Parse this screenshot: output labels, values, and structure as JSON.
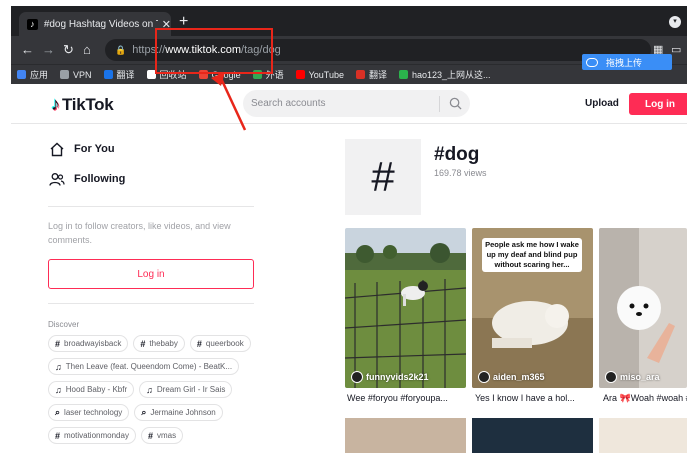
{
  "browser": {
    "tab_title": "#dog Hashtag Videos on TikTok",
    "tab_close": "✕",
    "new_tab": "+",
    "url_proto": "https://",
    "url_host": "www.tiktok.com",
    "url_path": "/tag/dog",
    "bookmarks": [
      {
        "label": "应用",
        "color": "#4285f4"
      },
      {
        "label": "VPN",
        "color": "#9aa0a6"
      },
      {
        "label": "翻译",
        "color": "#1a73e8"
      },
      {
        "label": "回收站",
        "color": "#ffffff"
      },
      {
        "label": "Google",
        "color": "#ea4335"
      },
      {
        "label": "外语",
        "color": "#34a853"
      },
      {
        "label": "YouTube",
        "color": "#ff0000"
      },
      {
        "label": "翻译",
        "color": "#d93025"
      },
      {
        "label": "hao123_上网从这...",
        "color": "#2bb24c"
      }
    ],
    "upload_pill_label": "拖拽上传"
  },
  "header": {
    "logo_text": "TikTok",
    "search_placeholder": "Search accounts",
    "upload_label": "Upload",
    "login_label": "Log in"
  },
  "sidebar": {
    "nav": [
      {
        "label": "For You",
        "icon": "home-icon"
      },
      {
        "label": "Following",
        "icon": "people-icon"
      }
    ],
    "hint": "Log in to follow creators, like videos, and view comments.",
    "login_label": "Log in",
    "discover_title": "Discover",
    "discover": [
      {
        "kind": "hashtag",
        "label": "broadwayisback"
      },
      {
        "kind": "hashtag",
        "label": "thebaby"
      },
      {
        "kind": "hashtag",
        "label": "queerbook"
      },
      {
        "kind": "music",
        "label": "Then Leave (feat. Queendom Come) - BeatK..."
      },
      {
        "kind": "music",
        "label": "Hood Baby - Kbfr"
      },
      {
        "kind": "music",
        "label": "Dream Girl - Ir Sais"
      },
      {
        "kind": "search",
        "label": "laser technology"
      },
      {
        "kind": "search",
        "label": "Jermaine Johnson"
      },
      {
        "kind": "hashtag",
        "label": "motivationmonday"
      },
      {
        "kind": "hashtag",
        "label": "vmas"
      }
    ]
  },
  "tag": {
    "symbol": "#",
    "title": "#dog",
    "views": "169.78 views"
  },
  "videos": [
    {
      "user": "funnyvids2k21",
      "desc": "Wee #foryou #foryoupa..."
    },
    {
      "user": "aiden_m365",
      "desc": "Yes I know I have a hol...",
      "overlay": "People ask me how I wake up my deaf and blind pup without scaring her..."
    },
    {
      "user": "miso_ara",
      "desc": "Ara 🎀Woah #woah #fo"
    }
  ]
}
